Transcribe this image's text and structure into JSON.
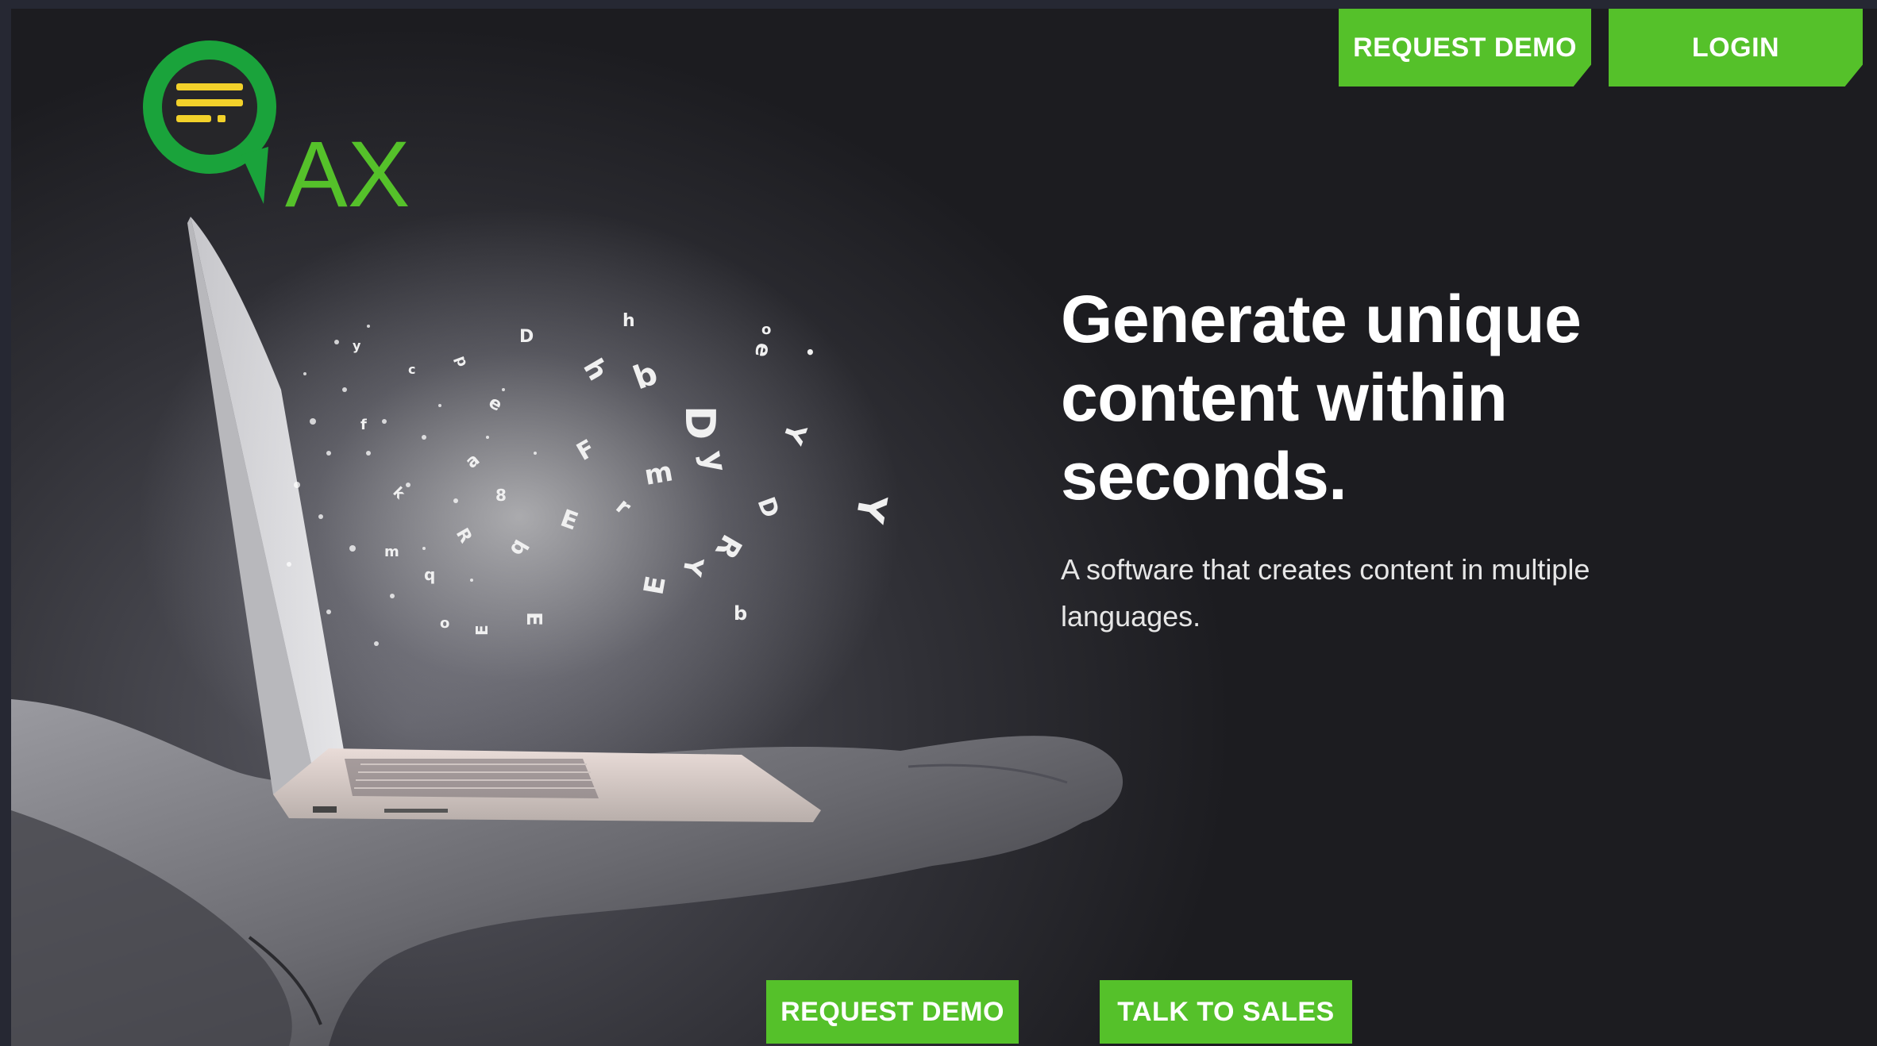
{
  "header": {
    "logo": {
      "text": "AX",
      "icon": "chat-bubble-lines-icon",
      "green": "#1aa33b",
      "yellow": "#f2d12a"
    },
    "request_demo_label": "REQUEST DEMO",
    "login_label": "LOGIN"
  },
  "hero": {
    "headline": "Generate unique content within seconds.",
    "subheadline": "A software that creates content in multiple languages.",
    "image": "hand-holding-laptop-with-flying-letters"
  },
  "cta": {
    "request_demo_label": "REQUEST DEMO",
    "talk_to_sales_label": "TALK TO SALES"
  },
  "colors": {
    "accent": "#55c12a",
    "background": "#1c1c20",
    "outer": "#262833"
  }
}
